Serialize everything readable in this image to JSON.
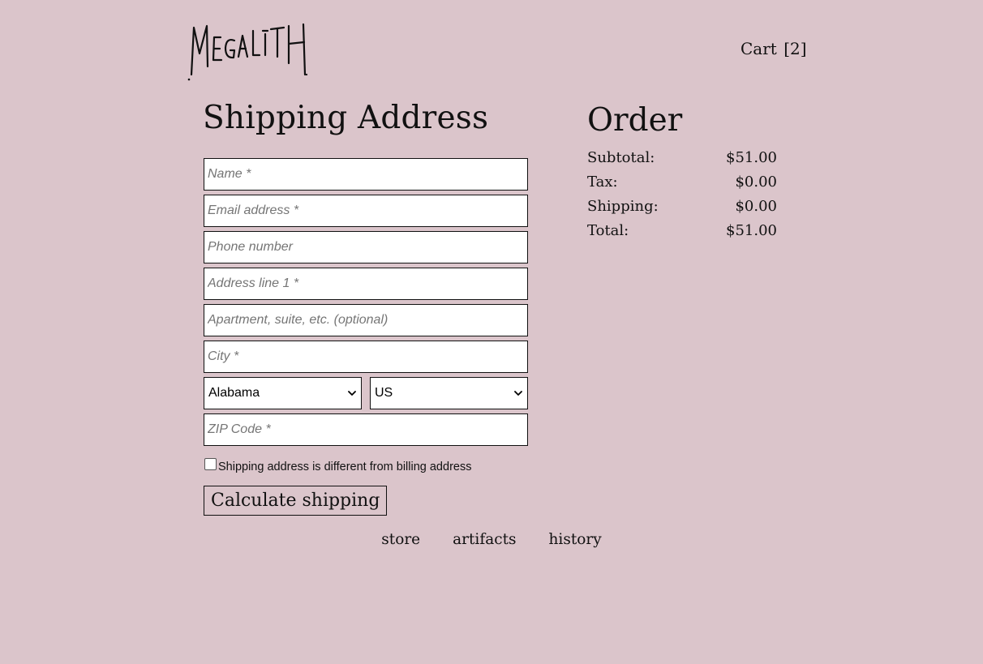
{
  "header": {
    "logo_text": "MEGALITH",
    "cart_label": "Cart",
    "cart_count": "[2]"
  },
  "shipping": {
    "title": "Shipping Address",
    "fields": {
      "name": {
        "placeholder": "Name *",
        "value": ""
      },
      "email": {
        "placeholder": "Email address *",
        "value": ""
      },
      "phone": {
        "placeholder": "Phone number",
        "value": ""
      },
      "address1": {
        "placeholder": "Address line 1 *",
        "value": ""
      },
      "address2": {
        "placeholder": "Apartment, suite, etc. (optional)",
        "value": ""
      },
      "city": {
        "placeholder": "City *",
        "value": ""
      },
      "zip": {
        "placeholder": "ZIP Code *",
        "value": ""
      }
    },
    "state_selected": "Alabama",
    "country_selected": "US",
    "different_billing_label": "Shipping address is different from billing address",
    "different_billing_checked": false,
    "calculate_button": "Calculate shipping"
  },
  "order": {
    "title": "Order",
    "rows": [
      {
        "label": "Subtotal:",
        "value": "$51.00"
      },
      {
        "label": "Tax:",
        "value": "$0.00"
      },
      {
        "label": "Shipping:",
        "value": "$0.00"
      },
      {
        "label": "Total:",
        "value": "$51.00"
      }
    ]
  },
  "footer": {
    "links": [
      "store",
      "artifacts",
      "history"
    ]
  },
  "colors": {
    "background": "#dbc5cb",
    "text": "#111111",
    "field_background": "#ffffff"
  },
  "icons": {
    "select_arrow": "chevron-down-icon"
  }
}
